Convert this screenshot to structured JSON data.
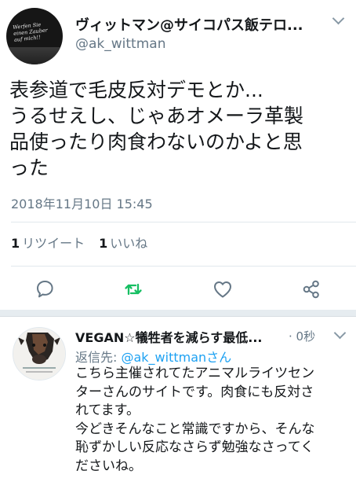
{
  "tweet": {
    "display_name": "ヴィットマン@サイコパス飯テロ...",
    "handle": "@ak_wittman",
    "avatar_text": [
      "Werfen Sie",
      "einen Zauber",
      "auf mich!!"
    ],
    "text_lines": [
      "表参道で毛皮反対デモとか...",
      "うるせえし、じゃあオメーラ革製",
      "品使ったり肉食わないのかよと思",
      "った"
    ],
    "timestamp": "2018年11月10日 15:45",
    "retweet_count": "1",
    "retweet_label": "リツイート",
    "like_count": "1",
    "like_label": "いいね"
  },
  "actions": {
    "reply_icon": "speech-bubble-icon",
    "retweet_icon": "retweet-arrows-icon",
    "like_icon": "heart-icon",
    "share_icon": "share-nodes-icon",
    "retweet_active_color": "#17bf63"
  },
  "reply": {
    "display_name": "VEGAN☆犠牲者を減らす最低...",
    "time": "· 0秒",
    "reply_prefix": "返信先: ",
    "reply_to_handle": "@ak_wittmanさん",
    "text_lines": [
      "こちら主催されてたアニマルライツセン",
      "ターさんのサイトです。肉食にも反対さ",
      "れてます。",
      "今どきそんなこと常識ですから、そんな",
      "恥ずかしい反応なさらず勉強なさってく",
      "ださいね。"
    ]
  },
  "colors": {
    "text": "#14171a",
    "muted": "#657786",
    "link": "#1da1f2",
    "divider": "#e1e8ed",
    "section_bg": "#e6ecf0"
  }
}
